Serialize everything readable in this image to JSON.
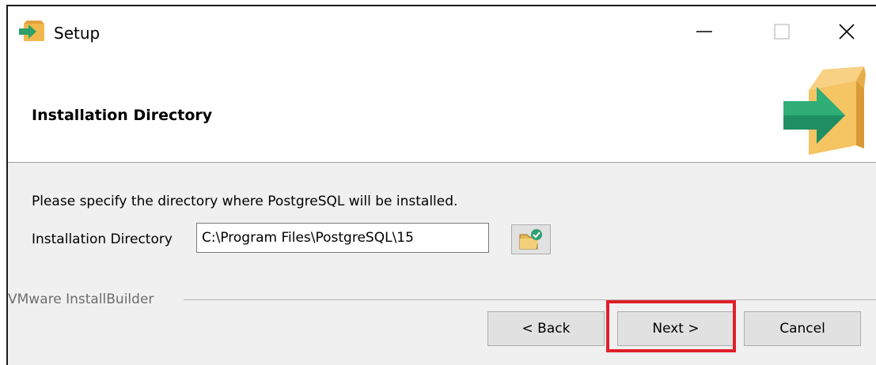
{
  "window": {
    "title": "Setup",
    "controls": {
      "minimize": "minimize-icon",
      "maximize": "maximize-icon",
      "close": "close-icon"
    }
  },
  "header": {
    "title": "Installation Directory",
    "logo": "box-arrow-icon"
  },
  "body": {
    "prompt": "Please specify the directory where PostgreSQL will be installed.",
    "directory_label": "Installation Directory",
    "directory_value": "C:\\Program Files\\PostgreSQL\\15",
    "browse_icon": "folder-browse-icon"
  },
  "footer": {
    "brand": "VMware InstallBuilder",
    "back_label": "< Back",
    "next_label": "Next >",
    "cancel_label": "Cancel"
  },
  "colors": {
    "highlight": "#e0202a",
    "icon_green": "#2e9e6a",
    "icon_box": "#f0b84c"
  }
}
